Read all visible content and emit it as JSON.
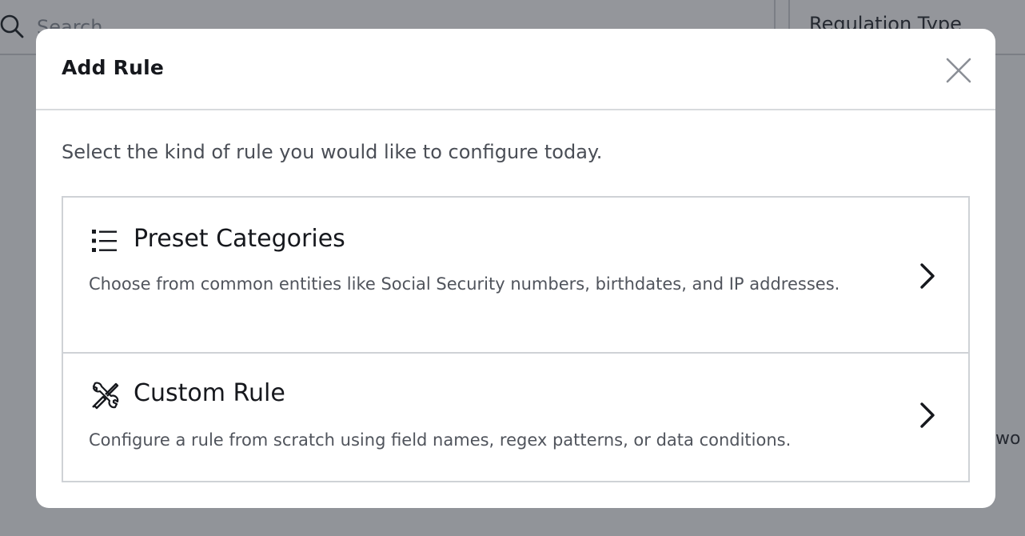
{
  "background": {
    "search": {
      "placeholder": "Search"
    },
    "filter": {
      "label": "Regulation Type"
    },
    "peek_text": "wo"
  },
  "modal": {
    "title": "Add Rule",
    "close_icon": "close-icon",
    "intro": "Select the kind of rule you would like to configure today.",
    "options": [
      {
        "icon": "list-icon",
        "title": "Preset Categories",
        "description": "Choose from common entities like Social Security numbers, birthdates, and IP addresses."
      },
      {
        "icon": "tools-icon",
        "title": "Custom Rule",
        "description": "Configure a rule from scratch using field names, regex patterns, or data conditions."
      }
    ]
  }
}
